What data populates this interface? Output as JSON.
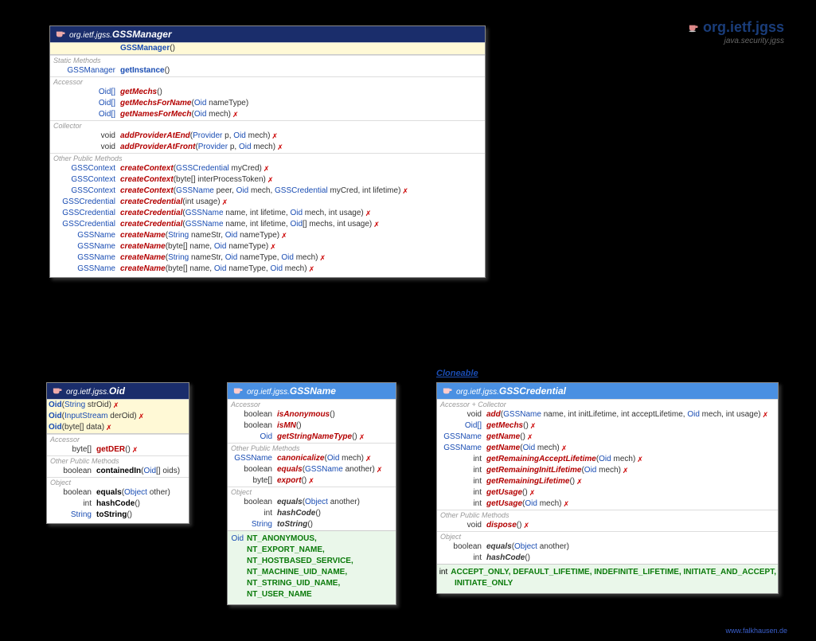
{
  "title": {
    "package": "org.ietf.jgss",
    "subtitle": "java.security.jgss"
  },
  "interface_label": "Cloneable",
  "footer": "www.falkhausen.de",
  "gssmanager": {
    "pkg": "org.ietf.jgss.",
    "name": "GSSManager",
    "constructor": "GSSManager",
    "static_label": "Static Methods",
    "getInstance_rt": "GSSManager",
    "getInstance": "getInstance",
    "accessor_label": "Accessor",
    "getMechs_rt": "Oid[]",
    "getMechs": "getMechs",
    "getMechsForName_rt": "Oid[]",
    "getMechsForName": "getMechsForName",
    "getMechsForName_p": "(Oid nameType)",
    "getNamesForMech_rt": "Oid[]",
    "getNamesForMech": "getNamesForMech",
    "getNamesForMech_p": "(Oid mech)",
    "collector_label": "Collector",
    "addProviderAtEnd_rt": "void",
    "addProviderAtEnd": "addProviderAtEnd",
    "addProviderAtEnd_p": "(Provider p, Oid mech)",
    "addProviderAtFront_rt": "void",
    "addProviderAtFront": "addProviderAtFront",
    "addProviderAtFront_p": "(Provider p, Oid mech)",
    "other_label": "Other Public Methods",
    "cc1_rt": "GSSContext",
    "cc1": "createContext",
    "cc1_p": "(GSSCredential myCred)",
    "cc2_rt": "GSSContext",
    "cc2": "createContext",
    "cc2_p": "(byte[] interProcessToken)",
    "cc3_rt": "GSSContext",
    "cc3": "createContext",
    "cc3_p": "(GSSName peer, Oid mech, GSSCredential myCred, int lifetime)",
    "ccr1_rt": "GSSCredential",
    "ccr1": "createCredential",
    "ccr1_p": "(int usage)",
    "ccr2_rt": "GSSCredential",
    "ccr2": "createCredential",
    "ccr2_p": "(GSSName name, int lifetime, Oid mech, int usage)",
    "ccr3_rt": "GSSCredential",
    "ccr3": "createCredential",
    "ccr3_p": "(GSSName name, int lifetime, Oid[] mechs, int usage)",
    "cn1_rt": "GSSName",
    "cn1": "createName",
    "cn1_p": "(String nameStr, Oid nameType)",
    "cn2_rt": "GSSName",
    "cn2": "createName",
    "cn2_p": "(byte[] name, Oid nameType)",
    "cn3_rt": "GSSName",
    "cn3": "createName",
    "cn3_p": "(String nameStr, Oid nameType, Oid mech)",
    "cn4_rt": "GSSName",
    "cn4": "createName",
    "cn4_p": "(byte[] name, Oid nameType, Oid mech)"
  },
  "oid": {
    "pkg": "org.ietf.jgss.",
    "name": "Oid",
    "c1": "Oid",
    "c1_p": "(String strOid)",
    "c2": "Oid",
    "c2_p": "(InputStream derOid)",
    "c3": "Oid",
    "c3_p": "(byte[] data)",
    "accessor_label": "Accessor",
    "getDER_rt": "byte[]",
    "getDER": "getDER",
    "other_label": "Other Public Methods",
    "containedIn_rt": "boolean",
    "containedIn": "containedIn",
    "containedIn_p": "(Oid[] oids)",
    "object_label": "Object",
    "equals_rt": "boolean",
    "equals": "equals",
    "equals_p": "(Object other)",
    "hashCode_rt": "int",
    "hashCode": "hashCode",
    "toString_rt": "String",
    "toString": "toString"
  },
  "gssname": {
    "pkg": "org.ietf.jgss.",
    "name": "GSSName",
    "accessor_label": "Accessor",
    "isAnon_rt": "boolean",
    "isAnon": "isAnonymous",
    "isMN_rt": "boolean",
    "isMN": "isMN",
    "gsnt_rt": "Oid",
    "gsnt": "getStringNameType",
    "other_label": "Other Public Methods",
    "canon_rt": "GSSName",
    "canon": "canonicalize",
    "canon_p": "(Oid mech)",
    "eq_rt": "boolean",
    "eq": "equals",
    "eq_p": "(GSSName another)",
    "export_rt": "byte[]",
    "export": "export",
    "object_label": "Object",
    "equals_rt": "boolean",
    "equals": "equals",
    "equals_p": "(Object another)",
    "hashCode_rt": "int",
    "hashCode": "hashCode",
    "toString_rt": "String",
    "toString": "toString",
    "const_rt": "Oid",
    "const1": "NT_ANONYMOUS,",
    "const2": "NT_EXPORT_NAME,",
    "const3": "NT_HOSTBASED_SERVICE,",
    "const4": "NT_MACHINE_UID_NAME,",
    "const5": "NT_STRING_UID_NAME,",
    "const6": "NT_USER_NAME"
  },
  "gsscred": {
    "pkg": "org.ietf.jgss.",
    "name": "GSSCredential",
    "ac_label": "Accessor + Collector",
    "add_rt": "void",
    "add": "add",
    "add_p": "(GSSName name, int initLifetime, int acceptLifetime, Oid mech, int usage)",
    "getMechs_rt": "Oid[]",
    "getMechs": "getMechs",
    "getName_rt": "GSSName",
    "getName": "getName",
    "getName2_rt": "GSSName",
    "getName2": "getName",
    "getName2_p": "(Oid mech)",
    "gral_rt": "int",
    "gral": "getRemainingAcceptLifetime",
    "gral_p": "(Oid mech)",
    "gril_rt": "int",
    "gril": "getRemainingInitLifetime",
    "gril_p": "(Oid mech)",
    "grl_rt": "int",
    "grl": "getRemainingLifetime",
    "gu_rt": "int",
    "gu": "getUsage",
    "gu2_rt": "int",
    "gu2": "getUsage",
    "gu2_p": "(Oid mech)",
    "other_label": "Other Public Methods",
    "dispose_rt": "void",
    "dispose": "dispose",
    "object_label": "Object",
    "equals_rt": "boolean",
    "equals": "equals",
    "equals_p": "(Object another)",
    "hashCode_rt": "int",
    "hashCode": "hashCode",
    "const_rt": "int",
    "constA": "ACCEPT_ONLY, DEFAULT_LIFETIME, INDEFINITE_LIFETIME, INITIATE_AND_ACCEPT,",
    "constB": "INITIATE_ONLY"
  }
}
